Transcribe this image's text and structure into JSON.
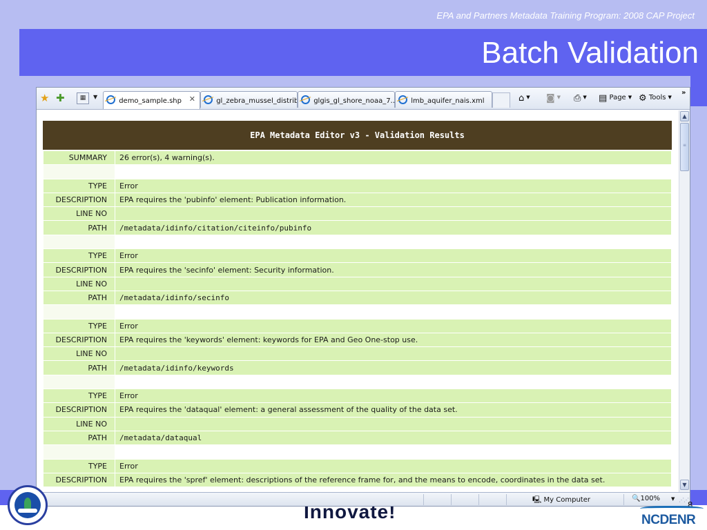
{
  "slide": {
    "subtitle": "EPA and Partners Metadata Training Program: 2008 CAP Project",
    "title": "Batch Validation",
    "page_number": "8"
  },
  "browser": {
    "tabs": [
      {
        "label": "demo_sample.shp",
        "active": true,
        "close_glyph": "✕"
      },
      {
        "label": "gl_zebra_mussel_distrib…",
        "active": false
      },
      {
        "label": "glgis_gl_shore_noaa_7…",
        "active": false
      },
      {
        "label": "lmb_aquifer_nais.xml",
        "active": false
      }
    ],
    "commands": {
      "page": "Page",
      "tools": "Tools"
    },
    "icons": {
      "favorites": "favorites-star-icon",
      "add_favorites": "add-favorites-icon",
      "quick_tabs": "quick-tabs-icon",
      "home": "home-icon",
      "feeds": "rss-feed-icon",
      "print": "printer-icon",
      "page": "page-icon",
      "tools": "gear-icon"
    },
    "status": {
      "zone": "My Computer",
      "zoom": "100%"
    }
  },
  "results": {
    "header": "EPA Metadata Editor v3 - Validation Results",
    "summary_label": "SUMMARY",
    "summary_value": "26 error(s), 4 warning(s).",
    "labels": {
      "type": "TYPE",
      "description": "DESCRIPTION",
      "line": "LINE NO",
      "path": "PATH"
    },
    "items": [
      {
        "type": "Error",
        "description": "EPA requires the 'pubinfo' element: Publication information.",
        "line": "",
        "path": "/metadata/idinfo/citation/citeinfo/pubinfo"
      },
      {
        "type": "Error",
        "description": "EPA requires the 'secinfo' element: Security information.",
        "line": "",
        "path": "/metadata/idinfo/secinfo"
      },
      {
        "type": "Error",
        "description": "EPA requires the 'keywords' element: keywords for EPA and Geo One-stop use.",
        "line": "",
        "path": "/metadata/idinfo/keywords"
      },
      {
        "type": "Error",
        "description": "EPA requires the 'dataqual' element: a general assessment of the quality of the data set.",
        "line": "",
        "path": "/metadata/dataqual"
      },
      {
        "type": "Error",
        "description": "EPA requires the 'spref' element: descriptions of the reference frame for, and the means to encode, coordinates in the data set."
      }
    ]
  },
  "footer": {
    "innovate_text": "Innovate!",
    "ncdenr_text": "NCDENR"
  },
  "colors": {
    "slide_bg": "#b7bdf2",
    "title_band": "#5f63f0",
    "table_header": "#4e3e21",
    "row_green": "#d9f2b4"
  }
}
